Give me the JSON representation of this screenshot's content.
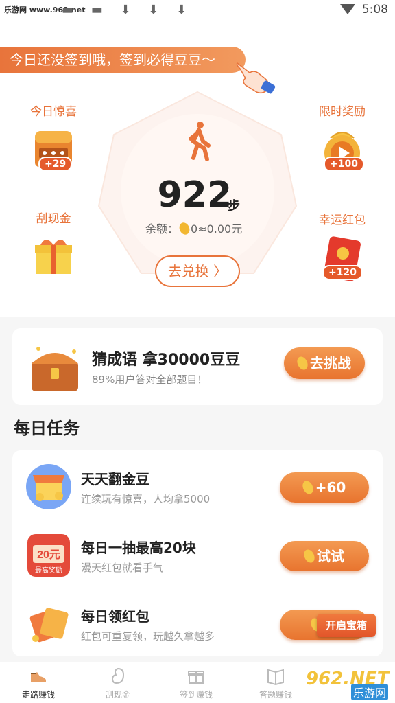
{
  "status_bar": {
    "site": "乐游网 www.962.net",
    "glyphs": "▬ ▬ ⬇ ⬇ ⬇",
    "time": "5:08"
  },
  "banner": {
    "text": "今日还没签到哦，签到必得豆豆～"
  },
  "steps": {
    "count": "922",
    "unit": "步",
    "balance_label": "余额：",
    "balance_value": "0≈0.00元",
    "exchange_label": "去兑换 〉"
  },
  "side": {
    "surprise": {
      "label": "今日惊喜",
      "badge": "+29"
    },
    "limited": {
      "label": "限时奖励",
      "badge": "+100"
    },
    "scratch": {
      "label": "刮现金"
    },
    "lucky": {
      "label": "幸运红包",
      "badge": "+120"
    }
  },
  "challenge": {
    "title": "猜成语 拿30000豆豆",
    "subtitle": "89%用户答对全部题目！",
    "button": "去挑战"
  },
  "daily": {
    "title": "每日任务",
    "tasks": [
      {
        "title": "天天翻金豆",
        "subtitle": "连续玩有惊喜，人均拿5000",
        "button": "+60"
      },
      {
        "title": "每日一抽最高20块",
        "subtitle": "漫天红包就看手气",
        "button": "试试",
        "icon_text": "20元",
        "icon_sub": "最高奖励"
      },
      {
        "title": "每日领红包",
        "subtitle": "红包可重复领，玩越久拿越多",
        "button": "￥"
      }
    ],
    "float_tag": "开启宝箱"
  },
  "nav": [
    {
      "label": "走路赚钱",
      "icon": "shoe-icon"
    },
    {
      "label": "刮现金",
      "icon": "bean-icon"
    },
    {
      "label": "签到赚钱",
      "icon": "gift-icon"
    },
    {
      "label": "答题赚钱",
      "icon": "book-icon"
    }
  ],
  "watermark": {
    "big": "962.NET",
    "small": "乐游网"
  },
  "colors": {
    "accent": "#e8743b",
    "accent_light": "#f39a52",
    "text": "#222222",
    "muted": "#999999"
  }
}
